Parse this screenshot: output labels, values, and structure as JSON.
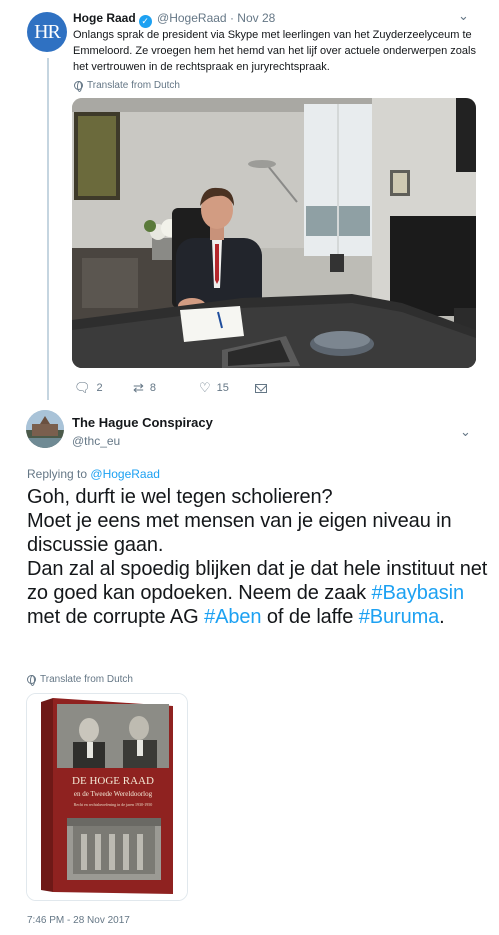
{
  "parent_tweet": {
    "avatar_text": "HR",
    "name": "Hoge Raad",
    "verified_glyph": "✓",
    "handle": "@HogeRaad",
    "separator": "·",
    "time": "Nov 28",
    "text": "Onlangs sprak de president via Skype met leerlingen van het Zuyderzeelyceum te Emmeloord. Ze vroegen hem het hemd van het lijf over actuele onderwerpen zoals het vertrouwen in de rechtspraak en juryrechtspraak.",
    "translate_label": "Translate from Dutch",
    "actions": {
      "reply_count": "2",
      "retweet_count": "8",
      "like_count": "15"
    }
  },
  "reply_tweet": {
    "name": "The Hague Conspiracy",
    "handle": "@thc_eu",
    "replying_to_label": "Replying to",
    "replying_to_handle": "@HogeRaad",
    "text_parts": {
      "line1": "Goh, durft ie wel tegen scholieren?",
      "line2": "Moet je eens met mensen van je eigen niveau in discussie gaan.",
      "line3a": "Dan zal al spoedig blijken dat je dat hele instituut net zo goed kan opdoeken. Neem de zaak ",
      "hashtag1": "#Baybasin",
      "line3b": " met de corrupte AG ",
      "hashtag2": "#Aben",
      "line3c": " of de laffe ",
      "hashtag3": "#Buruma",
      "line3d": "."
    },
    "translate_label": "Translate from Dutch",
    "book_cover": {
      "title_line1": "DE HOGE RAAD",
      "title_line2": "en de Tweede Wereldoorlog",
      "subtitle": "Recht en rechtsbeoefening in de jaren 1930-1950"
    },
    "timestamp": "7:46 PM - 28 Nov 2017"
  },
  "icons": {
    "chevron": "chevron-down-icon",
    "reply": "reply-icon",
    "retweet": "retweet-icon",
    "like": "heart-icon",
    "dm": "envelope-icon",
    "translate": "globe-icon"
  },
  "colors": {
    "link_blue": "#1da1f2",
    "muted_text": "#657786",
    "hr_avatar_blue": "#2f71c2",
    "book_red": "#8f2220"
  }
}
